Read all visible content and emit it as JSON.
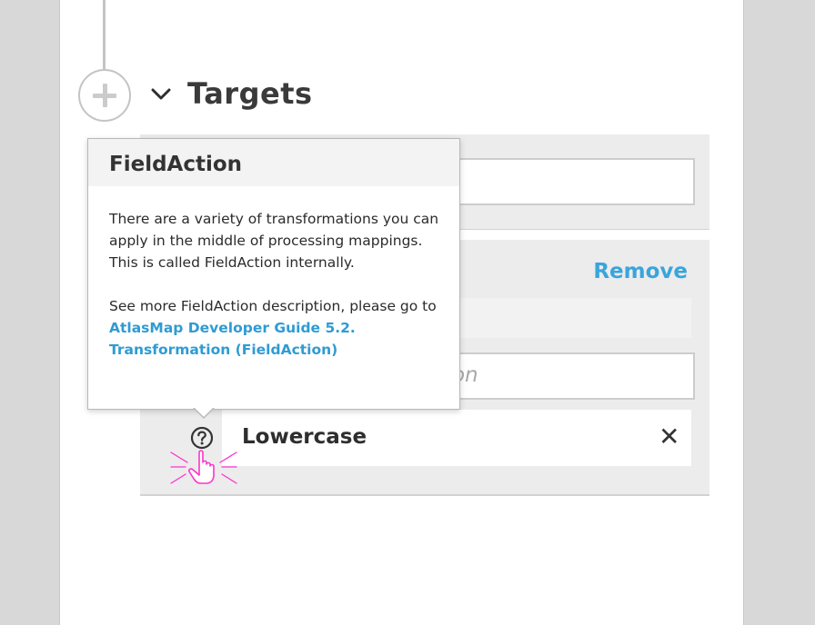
{
  "section": {
    "title": "Targets"
  },
  "card2": {
    "remove_label": "Remove",
    "action_placeholder": "ution"
  },
  "field_action": {
    "name": "Lowercase"
  },
  "popover": {
    "title": "FieldAction",
    "paragraph1": "There are a variety of transformations you can apply in the middle of processing mappings. This is called FieldAction internally.",
    "paragraph2_prefix": "See more FieldAction description, please go to ",
    "link_text": "AtlasMap Developer Guide 5.2. Transformation (FieldAction)"
  },
  "icons": {
    "add": "plus-circle-icon",
    "expand": "chevron-down-icon",
    "help": "question-circle-icon",
    "close": "close-icon",
    "cursor": "hand-pointer-icon"
  },
  "colors": {
    "link": "#39a5dc",
    "cursor_highlight": "#ff33cc"
  }
}
